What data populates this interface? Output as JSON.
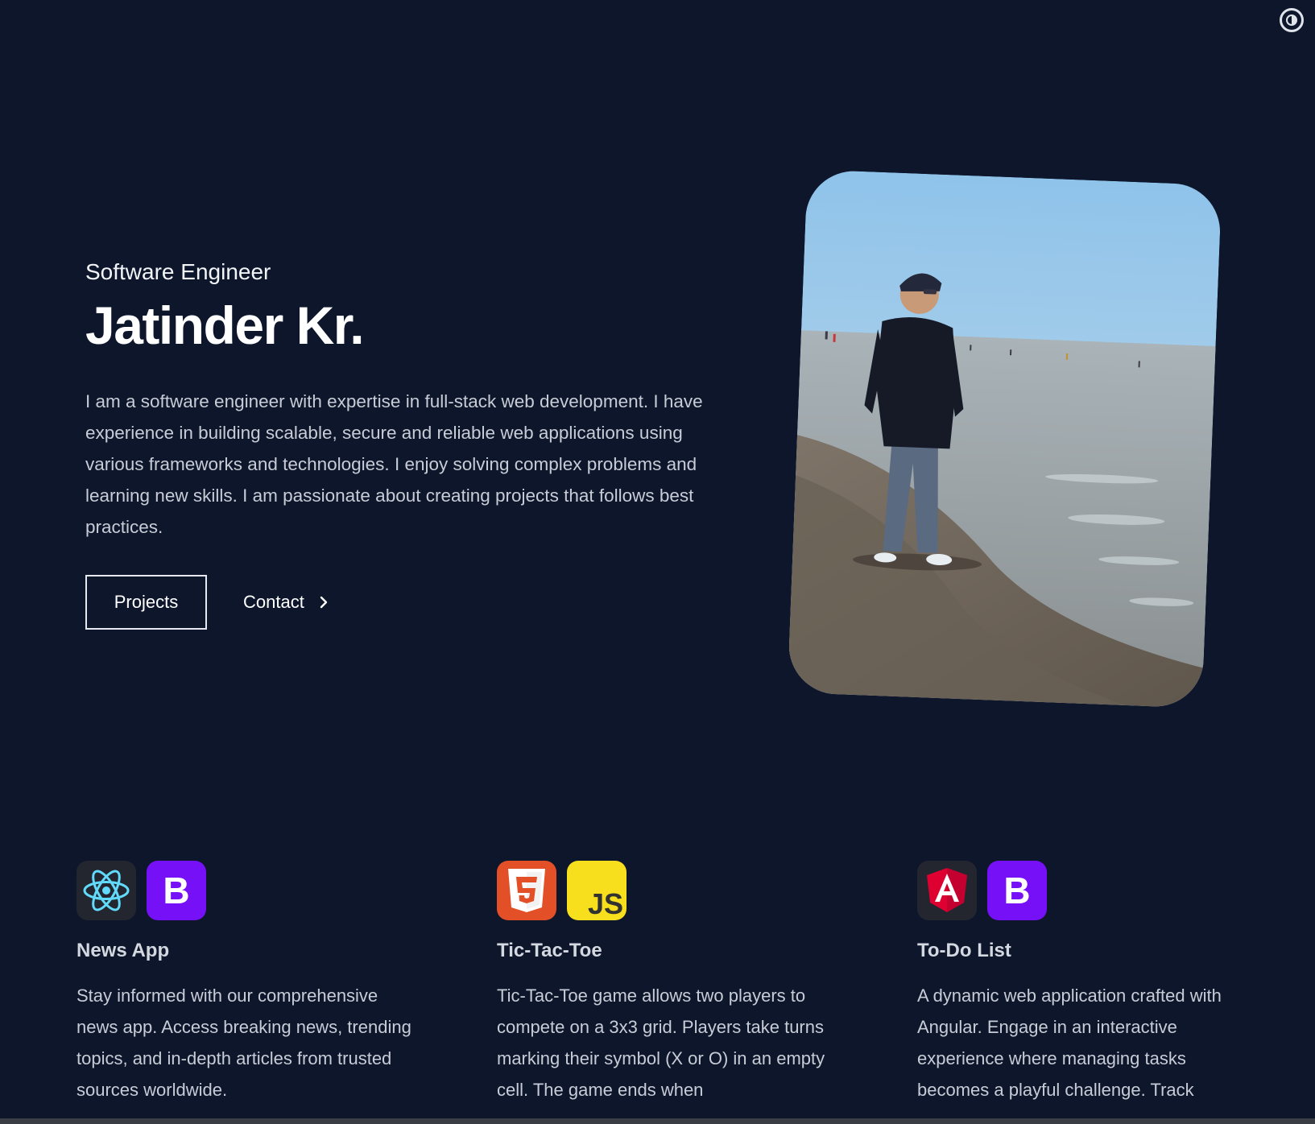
{
  "hero": {
    "role": "Software Engineer",
    "name": "Jatinder Kr.",
    "bio": "I am a software engineer with expertise in full-stack web development. I have experience in building scalable, secure and reliable web applications using various frameworks and technologies. I enjoy solving complex problems and learning new skills. I am passionate about creating projects that follows best practices.",
    "projects_label": "Projects",
    "contact_label": "Contact"
  },
  "projects": [
    {
      "title": "News App",
      "icons": [
        "react-icon",
        "bootstrap-icon"
      ],
      "description": "Stay informed with our comprehensive news app. Access breaking news, trending topics, and in-depth articles from trusted sources worldwide."
    },
    {
      "title": "Tic-Tac-Toe",
      "icons": [
        "html5-icon",
        "javascript-icon"
      ],
      "description": "Tic-Tac-Toe game allows two players to compete on a 3x3 grid. Players take turns marking their symbol (X or O) in an empty cell. The game ends when"
    },
    {
      "title": "To-Do List",
      "icons": [
        "angular-icon",
        "bootstrap-icon"
      ],
      "description": "A dynamic web application crafted with Angular. Engage in an interactive experience where managing tasks becomes a playful challenge. Track"
    }
  ],
  "colors": {
    "background": "#0d162b",
    "react": "#61dafb",
    "bootstrap": "#7611f7",
    "html5": "#e34f26",
    "javascript": "#f7df1e",
    "angular": "#dd0031"
  }
}
